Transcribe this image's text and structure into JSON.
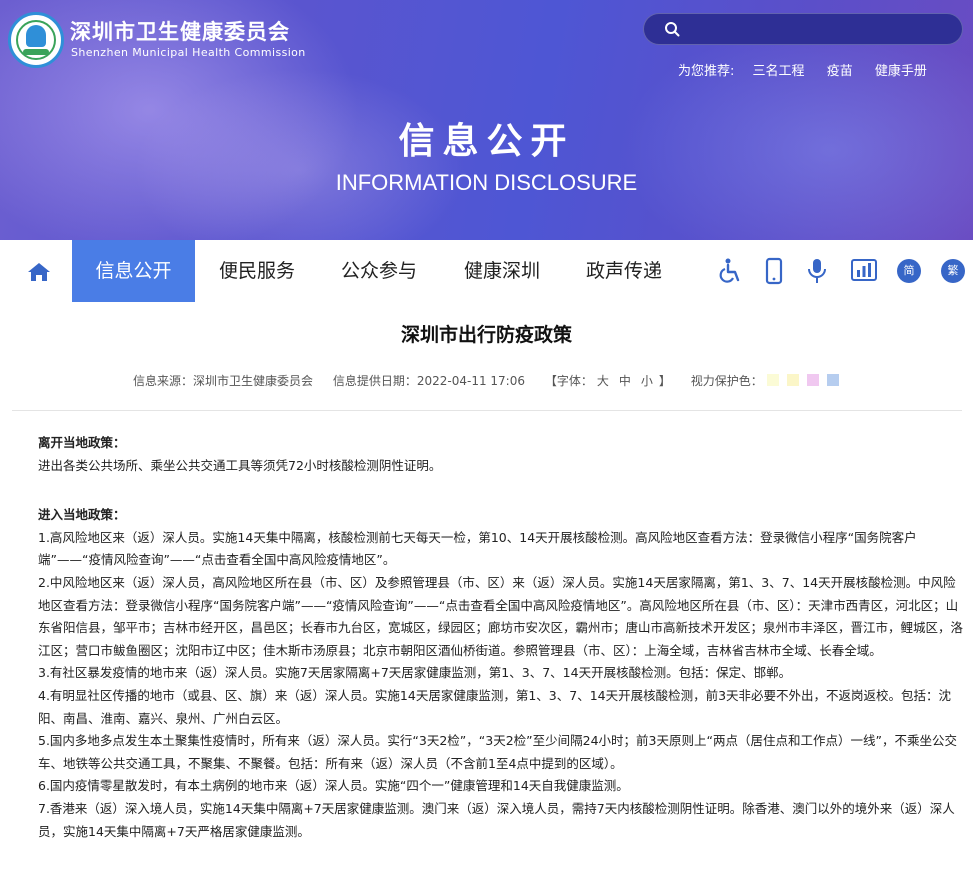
{
  "header": {
    "org_name_cn": "深圳市卫生健康委员会",
    "org_name_en": "Shenzhen Municipal Health Commission",
    "search_placeholder": "",
    "recommend_label": "为您推荐:",
    "recommend_items": [
      "三名工程",
      "疫苗",
      "健康手册"
    ]
  },
  "hero": {
    "title_cn": "信息公开",
    "title_en": "INFORMATION DISCLOSURE"
  },
  "nav": {
    "items": [
      "信息公开",
      "便民服务",
      "公众参与",
      "健康深圳",
      "政声传递"
    ],
    "active_index": 0,
    "simplified_label": "简",
    "traditional_label": "繁"
  },
  "article": {
    "title": "深圳市出行防疫政策",
    "source": "信息来源：深圳市卫生健康委员会",
    "date": "信息提供日期：2022-04-11 17:06",
    "font_label": "【字体：",
    "font_large": "大",
    "font_medium": "中",
    "font_small": "小",
    "font_close": "】",
    "eye_care_label": "视力保护色：",
    "eye_care_colors": [
      "#fbfbd6",
      "#fbf6c8",
      "#f0c8f0",
      "#b6cdef"
    ],
    "leave_heading": "离开当地政策：",
    "leave_text": "进出各类公共场所、乘坐公共交通工具等须凭72小时核酸检测阴性证明。",
    "enter_heading": "进入当地政策：",
    "enter_items": [
      "1.高风险地区来（返）深人员。实施14天集中隔离，核酸检测前七天每天一检，第10、14天开展核酸检测。高风险地区查看方法：登录微信小程序“国务院客户端”——“疫情风险查询”——“点击查看全国中高风险疫情地区”。",
      "2.中风险地区来（返）深人员，高风险地区所在县（市、区）及参照管理县（市、区）来（返）深人员。实施14天居家隔离，第1、3、7、14天开展核酸检测。中风险地区查看方法：登录微信小程序“国务院客户端”——“疫情风险查询”——“点击查看全国中高风险疫情地区”。高风险地区所在县（市、区）：天津市西青区，河北区；山东省阳信县，邹平市；吉林市经开区，昌邑区；长春市九台区，宽城区，绿园区；廊坊市安次区，霸州市；唐山市高新技术开发区；泉州市丰泽区，晋江市，鲤城区，洛江区；营口市鲅鱼圈区；沈阳市辽中区；佳木斯市汤原县；北京市朝阳区酒仙桥街道。参照管理县（市、区）：上海全域，吉林省吉林市全域、长春全域。",
      "3.有社区暴发疫情的地市来（返）深人员。实施7天居家隔离+7天居家健康监测，第1、3、7、14天开展核酸检测。包括：保定、邯郸。",
      "4.有明显社区传播的地市（或县、区、旗）来（返）深人员。实施14天居家健康监测，第1、3、7、14天开展核酸检测，前3天非必要不外出，不返岗返校。包括：沈阳、南昌、淮南、嘉兴、泉州、广州白云区。",
      "5.国内多地多点发生本土聚集性疫情时，所有来（返）深人员。实行“3天2检”，“3天2检”至少间隔24小时；前3天原则上“两点（居住点和工作点）一线”，不乘坐公交车、地铁等公共交通工具，不聚集、不聚餐。包括：所有来（返）深人员（不含前1至4点中提到的区域）。",
      "6.国内疫情零星散发时，有本土病例的地市来（返）深人员。实施“四个一”健康管理和14天自我健康监测。",
      "7.香港来（返）深入境人员，实施14天集中隔离+7天居家健康监测。澳门来（返）深入境人员，需持7天内核酸检测阴性证明。除香港、澳门以外的境外来（返）深人员，实施14天集中隔离+7天严格居家健康监测。"
    ]
  }
}
